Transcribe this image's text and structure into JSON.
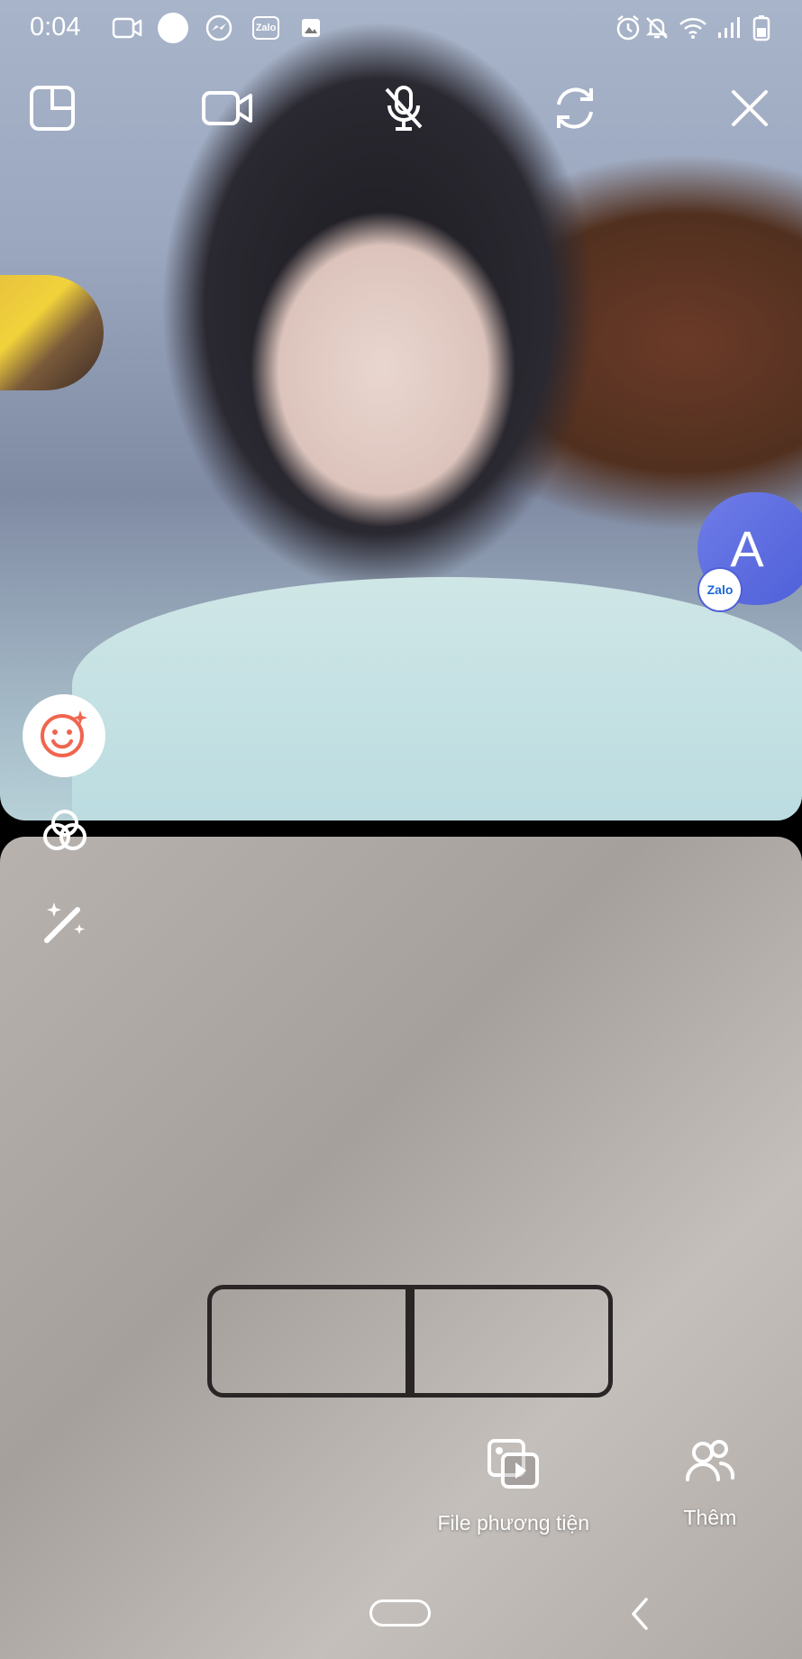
{
  "status_bar": {
    "time": "0:04",
    "icons": [
      "video-camera-icon",
      "circle-icon",
      "messenger-icon",
      "zalo-icon",
      "image-icon",
      "alarm-icon",
      "mute-icon",
      "wifi-icon",
      "signal-icon",
      "battery-icon"
    ],
    "zalo_mini_text": "Zalo"
  },
  "controls": {
    "icons": [
      "minimize-window-icon",
      "camera-toggle-icon",
      "mic-muted-icon",
      "switch-camera-icon",
      "close-icon"
    ]
  },
  "remote_avatar": {
    "initial": "A",
    "badge_text": "Zalo"
  },
  "side_tools": [
    "beauty-face-icon",
    "filters-icon",
    "magic-wand-icon"
  ],
  "actions": [
    {
      "label": "File phương tiện",
      "icon": "media-file-icon"
    },
    {
      "label": "Thêm",
      "icon": "add-people-icon"
    }
  ],
  "colors": {
    "avatar_bg": "#5a6ae0",
    "beauty_accent": "#f0654f"
  }
}
